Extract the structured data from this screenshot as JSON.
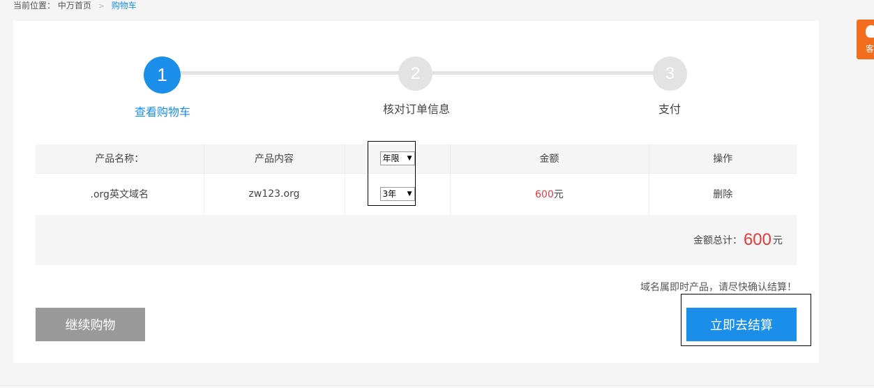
{
  "breadcrumb": {
    "prefix": "当前位置：",
    "home": "中万首页",
    "separator": ">",
    "current": "购物车"
  },
  "steps": [
    {
      "num": "1",
      "label": "查看购物车",
      "active": true
    },
    {
      "num": "2",
      "label": "核对订单信息",
      "active": false
    },
    {
      "num": "3",
      "label": "支付",
      "active": false
    }
  ],
  "table": {
    "headers": {
      "name": "产品名称：",
      "content": "产品内容",
      "term_select": "年限",
      "amount": "金额",
      "action": "操作"
    },
    "rows": [
      {
        "name": ".org英文域名",
        "content": "zw123.org",
        "term": "3年",
        "price": "600",
        "price_unit": "元",
        "action": "删除"
      }
    ]
  },
  "summary": {
    "label": "金额总计：",
    "amount": "600",
    "unit": "元"
  },
  "notice": "域名属即时产品，请尽快确认结算！",
  "buttons": {
    "continue": "继续购物",
    "checkout": "立即去结算"
  },
  "float_service": {
    "label": "客"
  },
  "colors": {
    "accent": "#1a8ee8",
    "price": "#e4393c",
    "service": "#f26d1d",
    "grey_button": "#999999"
  }
}
